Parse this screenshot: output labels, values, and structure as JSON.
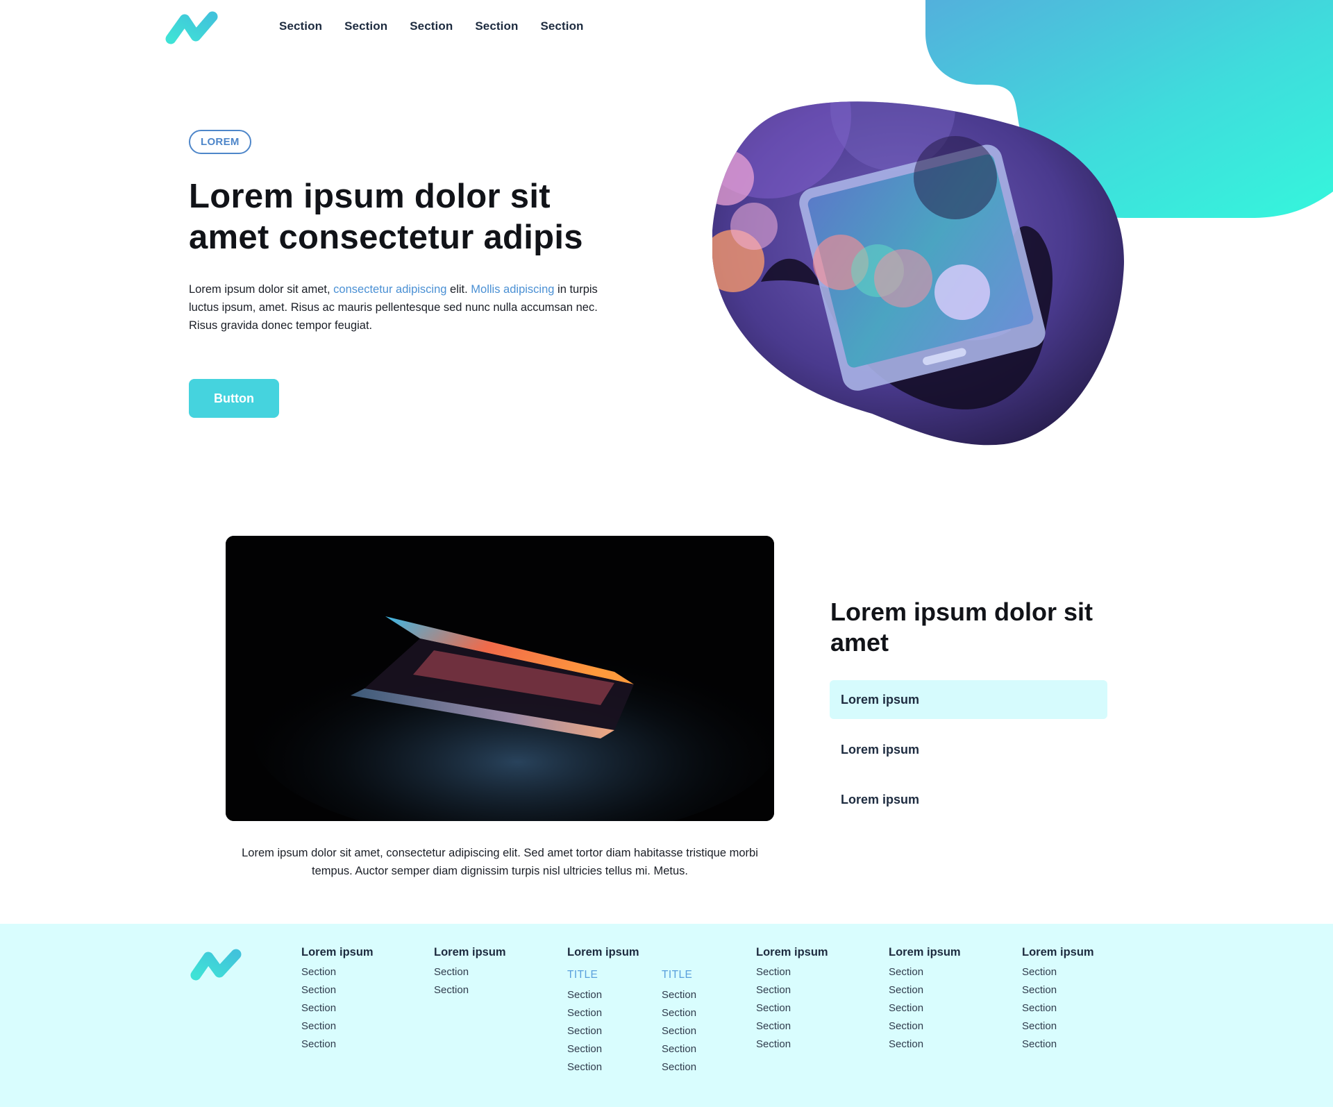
{
  "colors": {
    "accent_teal": "#45d3de",
    "link_blue": "#4a90d4",
    "badge_blue": "#4e86c9",
    "footer_bg": "#d9fdfe",
    "active_item_bg": "#d6fbfd",
    "heading_dark": "#111318",
    "nav_dark": "#1d2b3f"
  },
  "header": {
    "logo_icon": "brand-logo-icon",
    "nav": [
      "Section",
      "Section",
      "Section",
      "Section",
      "Section"
    ]
  },
  "hero": {
    "badge": "LOREM",
    "title": "Lorem ipsum dolor sit amet consectetur adipis",
    "text": {
      "part1": "Lorem ipsum dolor sit amet, ",
      "link1": "consectetur adipiscing",
      "part2": " elit. ",
      "link2": "Mollis adipiscing",
      "part3": " in turpis luctus ipsum, amet. Risus ac mauris pellentesque sed nunc nulla accumsan nec. Risus gravida donec tempor feugiat."
    },
    "button": "Button",
    "image_icon": "phone-photo"
  },
  "feature": {
    "image_icon": "laptop-photo",
    "caption": "Lorem ipsum dolor sit amet, consectetur adipiscing elit. Sed amet tortor diam habitasse tristique morbi tempus. Auctor semper diam dignissim turpis nisl ultricies tellus mi. Metus.",
    "title": "Lorem ipsum dolor sit amet",
    "items": [
      "Lorem ipsum",
      "Lorem ipsum",
      "Lorem ipsum"
    ],
    "active_index": 0
  },
  "footer": {
    "logo_icon": "brand-logo-icon",
    "columns": [
      {
        "heading": "Lorem ipsum",
        "links": [
          "Section",
          "Section",
          "Section",
          "Section",
          "Section"
        ]
      },
      {
        "heading": "Lorem ipsum",
        "links": [
          "Section",
          "Section"
        ]
      },
      {
        "heading": "Lorem ipsum",
        "subcolumns": [
          {
            "title": "TITLE",
            "links": [
              "Section",
              "Section",
              "Section",
              "Section",
              "Section"
            ]
          },
          {
            "title": "TITLE",
            "links": [
              "Section",
              "Section",
              "Section",
              "Section",
              "Section"
            ]
          }
        ]
      },
      {
        "heading": "Lorem ipsum",
        "links": [
          "Section",
          "Section",
          "Section",
          "Section",
          "Section"
        ]
      },
      {
        "heading": "Lorem ipsum",
        "links": [
          "Section",
          "Section",
          "Section",
          "Section",
          "Section"
        ]
      },
      {
        "heading": "Lorem ipsum",
        "links": [
          "Section",
          "Section",
          "Section",
          "Section",
          "Section"
        ]
      }
    ]
  }
}
